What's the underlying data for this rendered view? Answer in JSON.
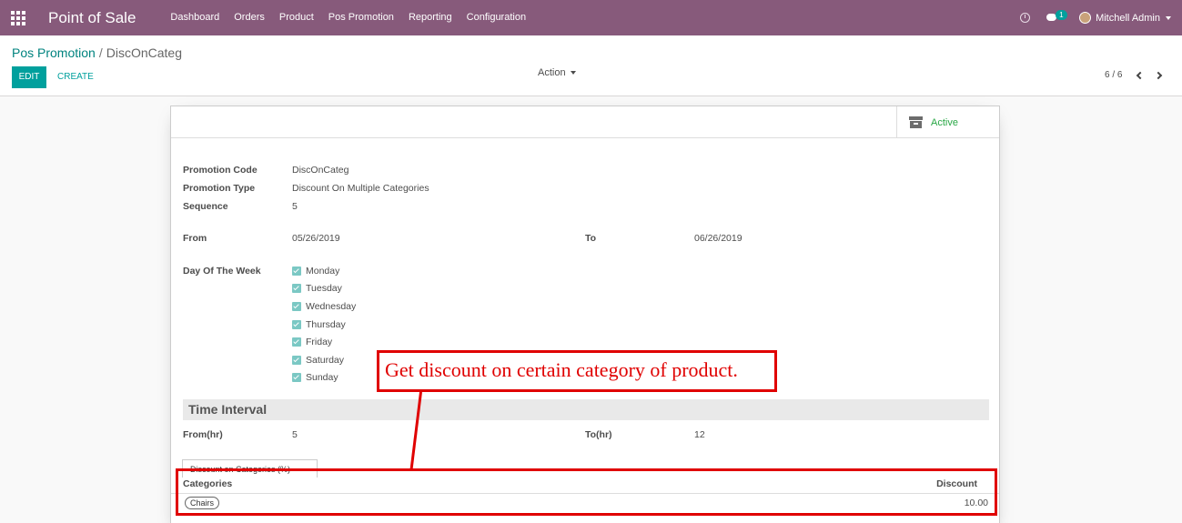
{
  "navbar": {
    "brand": "Point of Sale",
    "menu": [
      "Dashboard",
      "Orders",
      "Product",
      "Pos Promotion",
      "Reporting",
      "Configuration"
    ],
    "chat_badge": "1",
    "user_name": "Mitchell Admin"
  },
  "control_panel": {
    "breadcrumb_parent": "Pos Promotion",
    "breadcrumb_separator": "/",
    "breadcrumb_current": "DiscOnCateg",
    "edit_label": "EDIT",
    "create_label": "CREATE",
    "action_label": "Action",
    "pager": "6 / 6"
  },
  "form": {
    "active_label": "Active",
    "promotion_code_label": "Promotion Code",
    "promotion_code": "DiscOnCateg",
    "promotion_type_label": "Promotion Type",
    "promotion_type": "Discount On Multiple Categories",
    "sequence_label": "Sequence",
    "sequence": "5",
    "from_label": "From",
    "from_date": "05/26/2019",
    "to_label": "To",
    "to_date": "06/26/2019",
    "day_of_week_label": "Day Of The Week",
    "days": [
      "Monday",
      "Tuesday",
      "Wednesday",
      "Thursday",
      "Friday",
      "Saturday",
      "Sunday"
    ],
    "time_interval_title": "Time Interval",
    "from_hr_label": "From(hr)",
    "from_hr": "5",
    "to_hr_label": "To(hr)",
    "to_hr": "12",
    "tab_label": "Discount on Categories (%)",
    "table": {
      "headers": [
        "Categories",
        "Discount"
      ],
      "rows": [
        {
          "category": "Chairs",
          "discount": "10.00"
        }
      ]
    }
  },
  "annotation": {
    "callout_text": "Get discount on certain category of product."
  },
  "colors": {
    "navbar": "#875a7b",
    "primary": "#00a09d",
    "annotation": "#e00000",
    "active": "#28a745"
  }
}
